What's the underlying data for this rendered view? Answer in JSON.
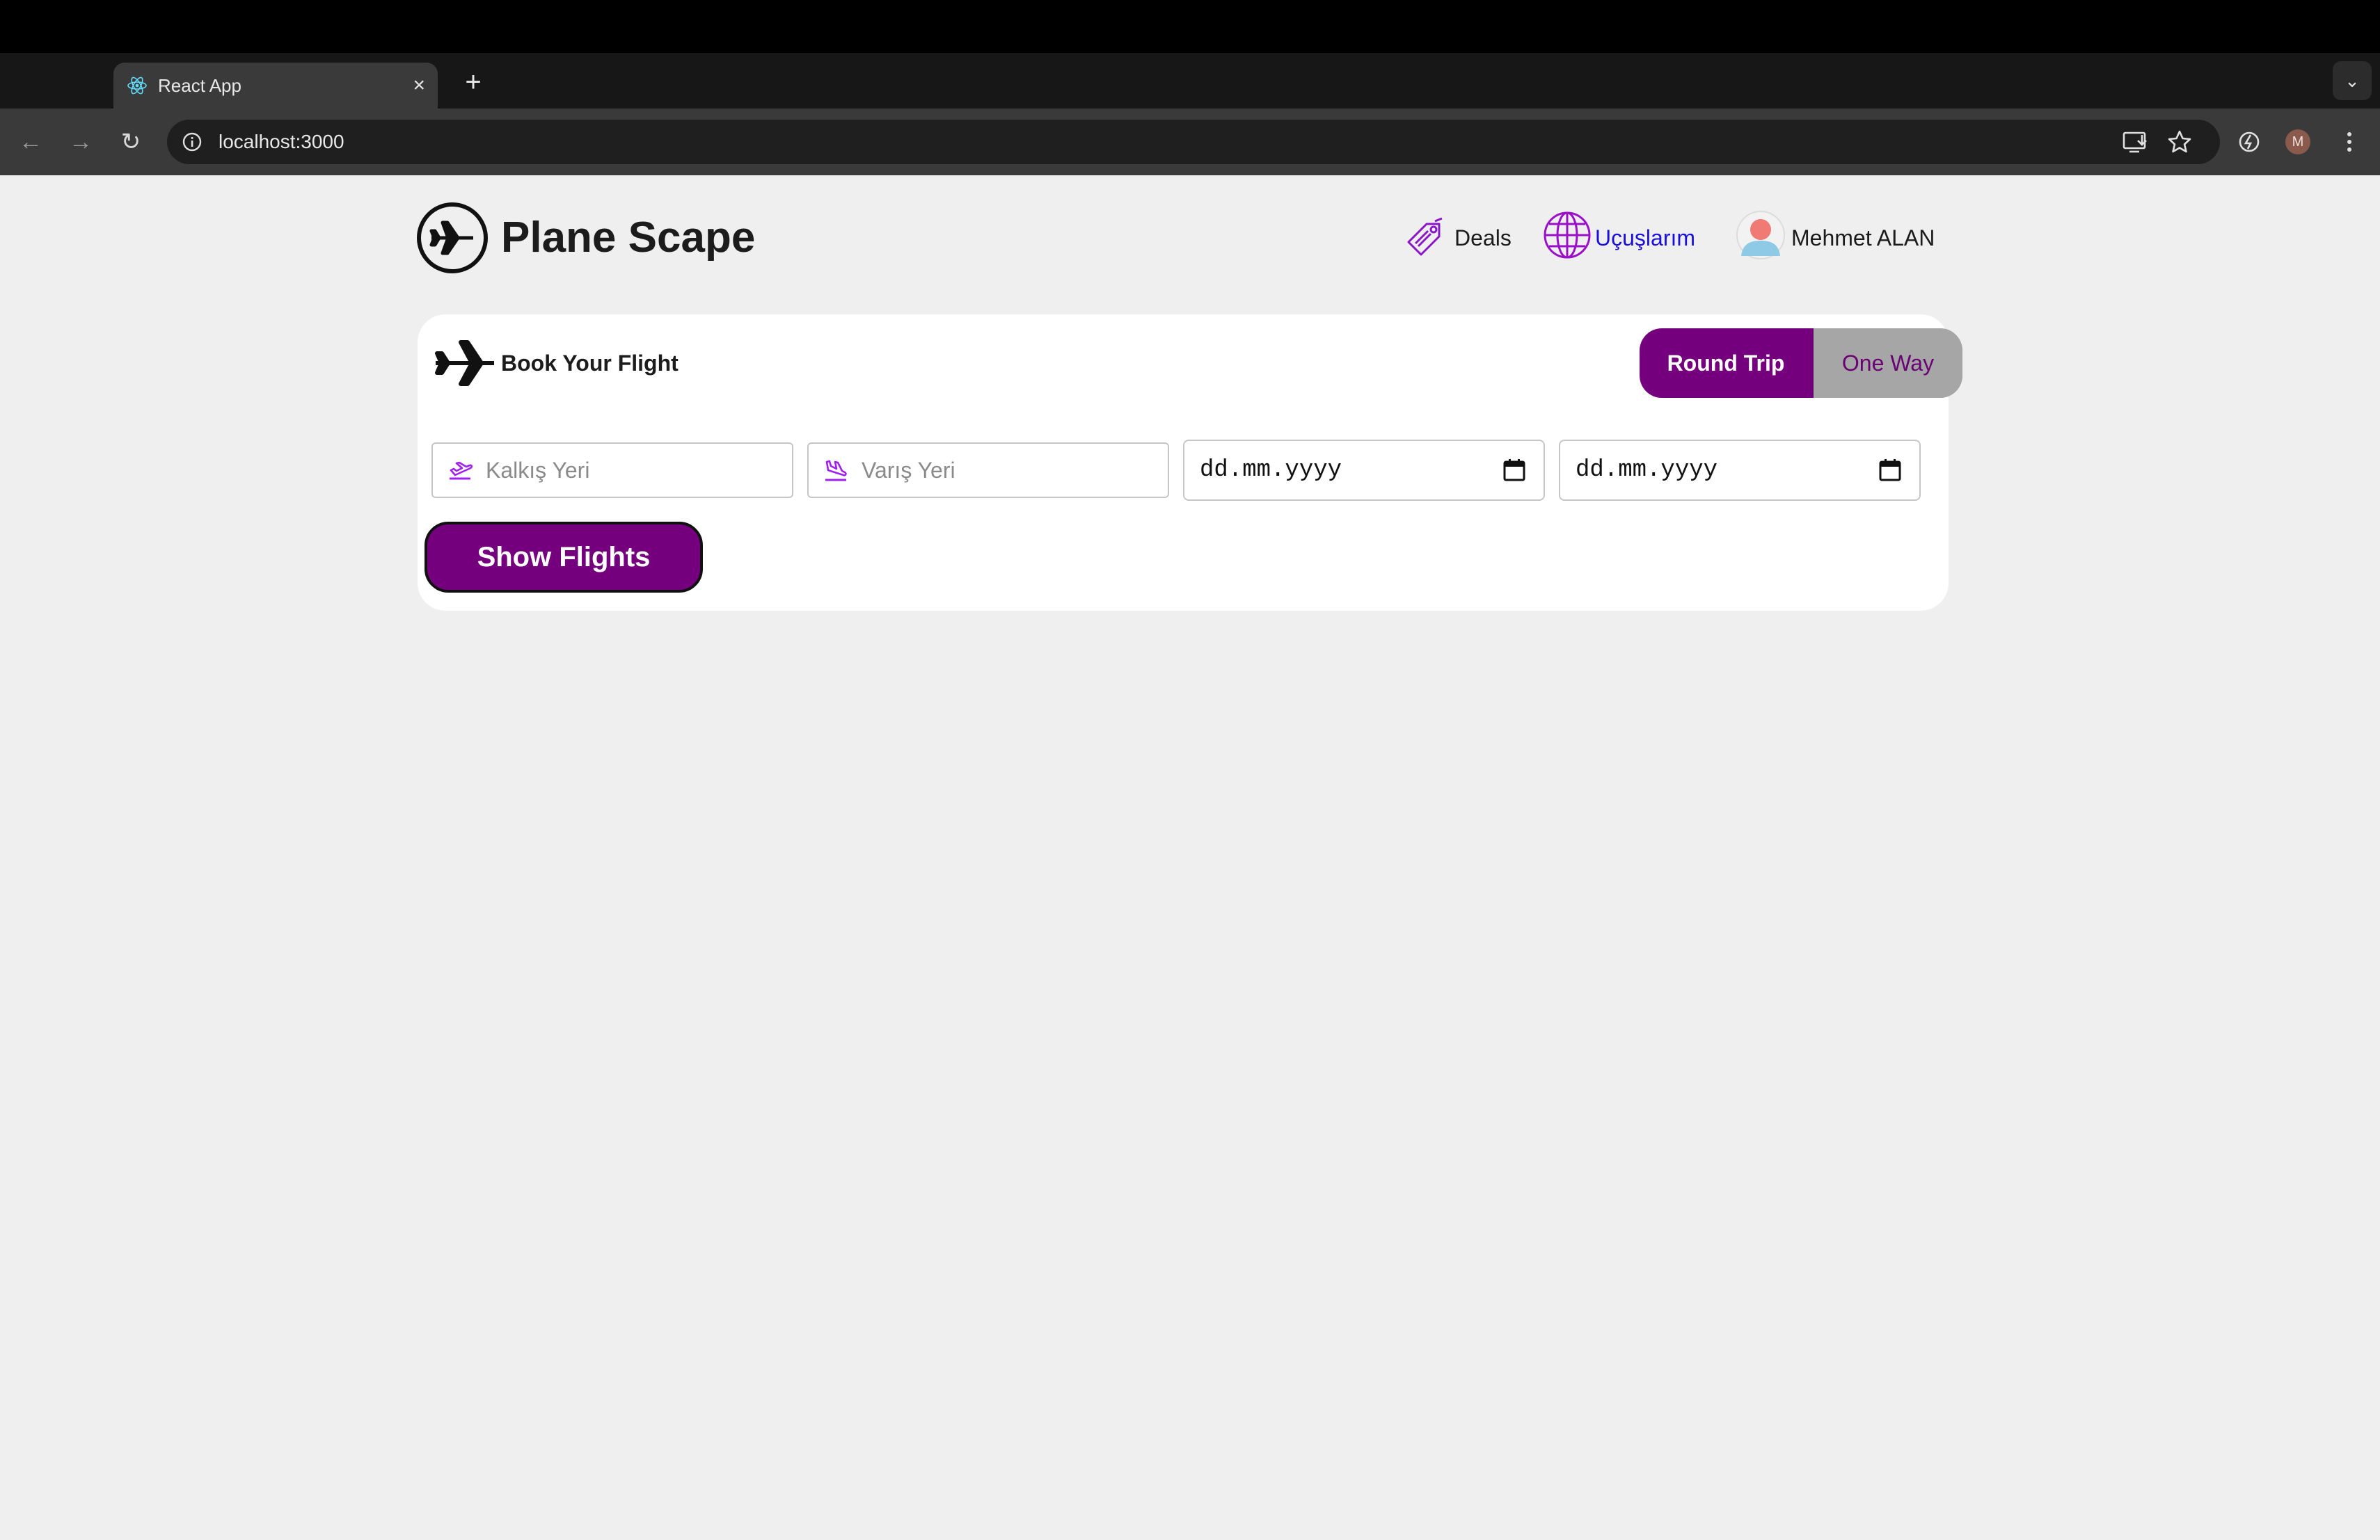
{
  "browser": {
    "tab_title": "React App",
    "tab_close": "×",
    "new_tab": "+",
    "tab_menu": "⌄",
    "url": "localhost:3000",
    "profile_initial": "M",
    "nav": {
      "back": "←",
      "forward": "→",
      "reload": "↻"
    }
  },
  "header": {
    "brand_name": "Plane Scape",
    "nav_deals": "Deals",
    "nav_flights": "Uçuşlarım",
    "user_name": "Mehmet ALAN"
  },
  "booking": {
    "title": "Book Your Flight",
    "round_trip": "Round Trip",
    "one_way": "One Way",
    "from_placeholder": "Kalkış Yeri",
    "to_placeholder": "Varış Yeri",
    "depart_date": "dd.mm.yyyy",
    "return_date": "dd.mm.yyyy",
    "show_flights": "Show Flights"
  },
  "colors": {
    "accent": "#74007e",
    "toggle_inactive": "#a6a6a6",
    "flights_link": "#1a10d8",
    "icon_purple": "#a020f0"
  },
  "icons": {
    "favicon": "react-icon",
    "brand": "airplane-circle-icon",
    "deals": "price-tag-icon",
    "flights": "globe-icon",
    "user": "user-avatar-icon",
    "card": "airplane-icon",
    "from": "plane-departure-icon",
    "to": "plane-arrival-icon",
    "calendar": "calendar-icon"
  }
}
